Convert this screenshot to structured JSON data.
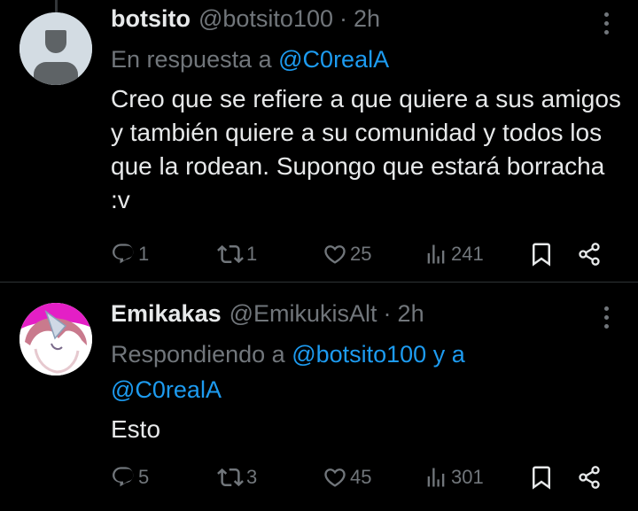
{
  "tweets": [
    {
      "display_name": "botsito",
      "handle": "@botsito100",
      "dot": "·",
      "time": "2h",
      "reply_prefix": "En respuesta a",
      "reply_mentions": "@C0realA",
      "text": "Creo que se refiere a que quiere a sus amigos y también quiere a su comunidad y todos los que la rodean. Supongo que estará borracha :v",
      "stats": {
        "replies": "1",
        "reposts": "1",
        "likes": "25",
        "views": "241"
      }
    },
    {
      "display_name": "Emikakas",
      "handle": "@EmikukisAlt",
      "dot": "·",
      "time": "2h",
      "reply_prefix": "Respondiendo a",
      "reply_mentions": "@botsito100 y a @C0realA",
      "text": "Esto",
      "stats": {
        "replies": "5",
        "reposts": "3",
        "likes": "45",
        "views": "301"
      }
    }
  ],
  "colors": {
    "background": "#000000",
    "text": "#e7e9ea",
    "muted": "#71767b",
    "link": "#1d9bf0",
    "divider": "#2f3336"
  },
  "icons": [
    "reply-icon",
    "repost-icon",
    "like-icon",
    "views-icon",
    "bookmark-icon",
    "share-icon",
    "more-icon"
  ]
}
